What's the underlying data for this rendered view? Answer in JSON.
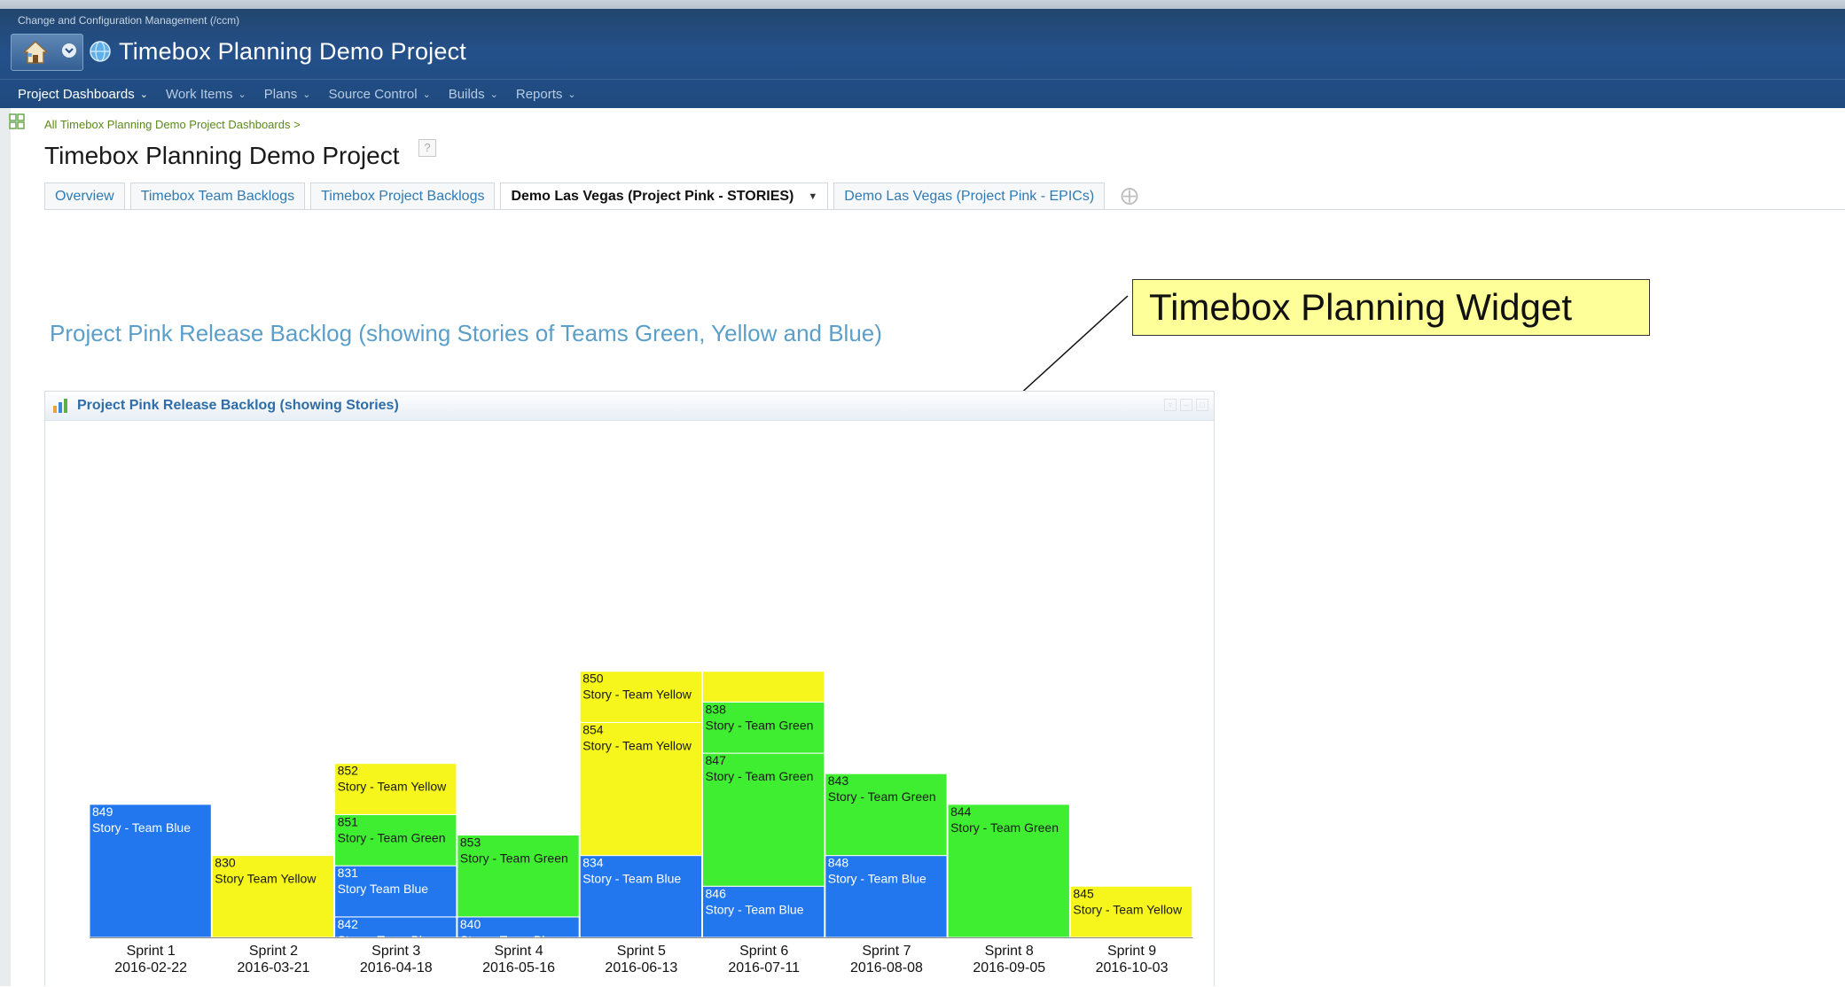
{
  "app": {
    "label": "Change and Configuration Management (/ccm)",
    "project_title": "Timebox Planning Demo Project"
  },
  "nav": [
    {
      "label": "Project Dashboards"
    },
    {
      "label": "Work Items"
    },
    {
      "label": "Plans"
    },
    {
      "label": "Source Control"
    },
    {
      "label": "Builds"
    },
    {
      "label": "Reports"
    }
  ],
  "breadcrumb": "All Timebox Planning Demo Project Dashboards >",
  "page_title": "Timebox Planning Demo Project",
  "help_glyph": "?",
  "tabs": [
    {
      "label": "Overview",
      "active": false
    },
    {
      "label": "Timebox Team Backlogs",
      "active": false
    },
    {
      "label": "Timebox Project Backlogs",
      "active": false
    },
    {
      "label": "Demo Las Vegas (Project Pink - STORIES)",
      "active": true
    },
    {
      "label": "Demo Las Vegas (Project Pink - EPICs)",
      "active": false
    }
  ],
  "section_title": "Project Pink Release Backlog (showing Stories of Teams Green, Yellow and Blue)",
  "callout": "Timebox Planning Widget",
  "widget": {
    "title": "Project Pink Release Backlog (showing Stories)"
  },
  "colors": {
    "blue": "#2277ee",
    "yellow": "#f6f61c",
    "green": "#3fee30"
  },
  "chart_data": {
    "type": "bar",
    "stacked": true,
    "categories": [
      "Sprint 1",
      "Sprint 2",
      "Sprint 3",
      "Sprint 4",
      "Sprint 5",
      "Sprint 6",
      "Sprint 7",
      "Sprint 8",
      "Sprint 9"
    ],
    "dates": [
      "2016-02-22",
      "2016-03-21",
      "2016-04-18",
      "2016-05-16",
      "2016-06-13",
      "2016-07-11",
      "2016-08-08",
      "2016-09-05",
      "2016-10-03"
    ],
    "stacks": [
      [
        {
          "id": "849",
          "label": "Story - Team Blue",
          "team": "blue",
          "value": 13
        }
      ],
      [
        {
          "id": "830",
          "label": "Story Team Yellow",
          "team": "yellow",
          "value": 8
        }
      ],
      [
        {
          "id": "842",
          "label": "Story - Team Blue",
          "team": "blue",
          "value": 2
        },
        {
          "id": "831",
          "label": "Story Team Blue",
          "team": "blue",
          "value": 5
        },
        {
          "id": "851",
          "label": "Story - Team Green",
          "team": "green",
          "value": 5
        },
        {
          "id": "852",
          "label": "Story - Team Yellow",
          "team": "yellow",
          "value": 5
        }
      ],
      [
        {
          "id": "840",
          "label": "Story - Team Blue",
          "team": "blue",
          "value": 2
        },
        {
          "id": "853",
          "label": "Story - Team Green",
          "team": "green",
          "value": 8
        }
      ],
      [
        {
          "id": "834",
          "label": "Story - Team Blue",
          "team": "blue",
          "value": 8
        },
        {
          "id": "854",
          "label": "Story - Team Yellow",
          "team": "yellow",
          "value": 13
        },
        {
          "id": "850",
          "label": "Story - Team Yellow",
          "team": "yellow",
          "value": 5
        }
      ],
      [
        {
          "id": "846",
          "label": "Story - Team Blue",
          "team": "blue",
          "value": 5
        },
        {
          "id": "847",
          "label": "Story - Team Green",
          "team": "green",
          "value": 13
        },
        {
          "id": "838",
          "label": "Story - Team Green",
          "team": "green",
          "value": 5
        },
        {
          "id": "",
          "label": "",
          "team": "yellow",
          "value": 3
        }
      ],
      [
        {
          "id": "848",
          "label": "Story - Team Blue",
          "team": "blue",
          "value": 8
        },
        {
          "id": "843",
          "label": "Story - Team Green",
          "team": "green",
          "value": 8
        }
      ],
      [
        {
          "id": "844",
          "label": "Story - Team Green",
          "team": "green",
          "value": 13
        }
      ],
      [
        {
          "id": "845",
          "label": "Story - Team Yellow",
          "team": "yellow",
          "value": 5
        }
      ]
    ]
  }
}
